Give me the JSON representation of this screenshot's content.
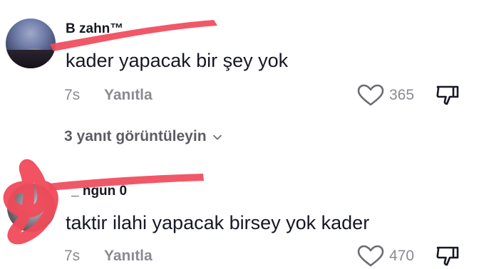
{
  "comments": [
    {
      "username": "B    zahn™",
      "text": "kader yapacak bir şey yok",
      "time": "7s",
      "reply_label": "Yanıtla",
      "likes": "365",
      "view_replies": "3 yanıt görüntüleyin"
    },
    {
      "username": "_    ngun 0",
      "text": "taktir ilahi yapacak birsey yok kader",
      "time": "7s",
      "reply_label": "Yanıtla",
      "likes": "470"
    }
  ],
  "icons": {
    "like": "heart-outline-icon",
    "dislike": "thumbs-down-icon",
    "expand": "chevron-down-icon"
  },
  "colors": {
    "text": "#161823",
    "muted": "#8a8b91",
    "redaction": "#f04a5a"
  }
}
